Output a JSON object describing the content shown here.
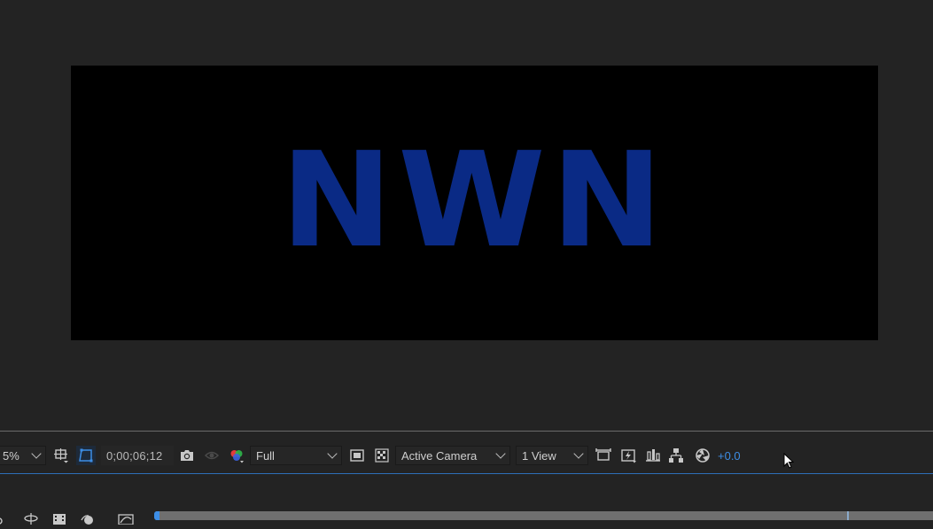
{
  "composition": {
    "text": "NWN",
    "text_color": "#0a2a85",
    "background_color": "#000000"
  },
  "toolbar": {
    "zoom_value": "5%",
    "timecode": "0;00;06;12",
    "resolution": "Full",
    "camera": "Active Camera",
    "view_layout": "1 View",
    "exposure": "+0.0"
  },
  "colors": {
    "panel_bg": "#232323",
    "accent_blue": "#3d8ee6",
    "timeline_bar": "#6f6f6f"
  },
  "icons": [
    "region-of-interest-icon",
    "mask-path-visibility-icon",
    "snapshot-camera-icon",
    "show-snapshot-icon",
    "color-channels-icon",
    "fast-previews-icon",
    "transparency-grid-icon",
    "reset-exposure-icon",
    "timeline-icon",
    "flowchart-icon",
    "3d-renderer-icon",
    "pixel-aspect-icon"
  ]
}
